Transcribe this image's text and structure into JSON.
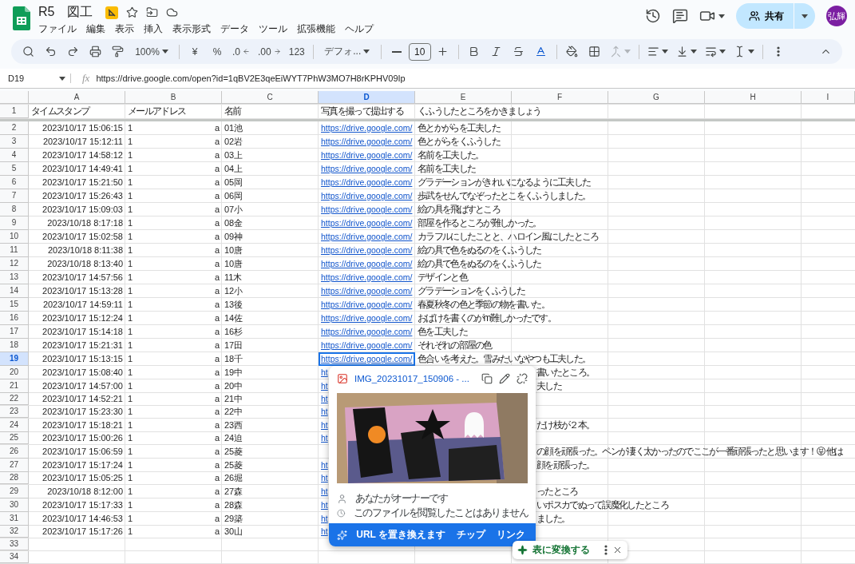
{
  "header": {
    "title": "R5　図工",
    "menu": [
      "ファイル",
      "編集",
      "表示",
      "挿入",
      "表示形式",
      "データ",
      "ツール",
      "拡張機能",
      "ヘルプ"
    ],
    "share_label": "共有",
    "avatar": "弘輝"
  },
  "toolbar": {
    "zoom": "100%",
    "currency": "¥",
    "percent": "%",
    "decrease_decimal": ".0",
    "increase_decimal": ".00",
    "number_format": "123",
    "font": "デフォ...",
    "font_size": "10",
    "merge_disabled": true
  },
  "formula_bar": {
    "cell_ref": "D19",
    "fx": "fx",
    "formula": "https://drive.google.com/open?id=1qBV2E3qeEiWYT7PhW3MO7H8rKPHV09Ip"
  },
  "columns": [
    {
      "label": "A",
      "selected": false
    },
    {
      "label": "B",
      "selected": false
    },
    {
      "label": "C",
      "selected": false
    },
    {
      "label": "D",
      "selected": true
    },
    {
      "label": "E",
      "selected": false
    },
    {
      "label": "F",
      "selected": false
    },
    {
      "label": "G",
      "selected": false
    },
    {
      "label": "H",
      "selected": false
    },
    {
      "label": "I",
      "selected": false
    }
  ],
  "header_row": {
    "number": "1",
    "cells": [
      "タイムスタンプ",
      "メールアドレス",
      "名前",
      "写真を撮って提出する",
      "くふうしたところをかきましょう"
    ]
  },
  "rows": [
    {
      "number": "2",
      "timestamp": "2023/10/17 15:06:15",
      "email": "1",
      "email_end": "a",
      "name": "01池",
      "link": "https://drive.google.com/",
      "note": "色とかがらを工夫した",
      "kind": "full",
      "selected": false
    },
    {
      "number": "3",
      "timestamp": "2023/10/17 15:12:11",
      "email": "1",
      "email_end": "a",
      "name": "02岩",
      "link": "https://drive.google.com/",
      "note": "色とがらをくふうした",
      "kind": "full",
      "selected": false
    },
    {
      "number": "4",
      "timestamp": "2023/10/17 14:58:12",
      "email": "1",
      "email_end": "a",
      "name": "03上",
      "link": "https://drive.google.com/",
      "note": "名前を工夫した。",
      "kind": "full",
      "selected": false
    },
    {
      "number": "5",
      "timestamp": "2023/10/17 14:49:41",
      "email": "1",
      "email_end": "a",
      "name": "04上",
      "link": "https://drive.google.com/",
      "note": "名前を工夫した",
      "kind": "full",
      "selected": false
    },
    {
      "number": "6",
      "timestamp": "2023/10/17 15:21:50",
      "email": "1",
      "email_end": "a",
      "name": "05岡",
      "link": "https://drive.google.com/",
      "note": "グラデーションがきれいになるように工夫した",
      "kind": "full",
      "selected": false
    },
    {
      "number": "7",
      "timestamp": "2023/10/17 15:26:43",
      "email": "1",
      "email_end": "a",
      "name": "06岡",
      "link": "https://drive.google.com/",
      "note": "歩武をせんでなぞったとこをくふうしました。",
      "kind": "full",
      "selected": false
    },
    {
      "number": "8",
      "timestamp": "2023/10/17 15:09:03",
      "email": "1",
      "email_end": "a",
      "name": "07小",
      "link": "https://drive.google.com/",
      "note": "絵の具を飛ばすところ",
      "kind": "full",
      "selected": false
    },
    {
      "number": "9",
      "timestamp": "2023/10/18 8:17:18",
      "email": "1",
      "email_end": "a",
      "name": "08金",
      "link": "https://drive.google.com/",
      "note": "部屋を作るところが難しかった。",
      "kind": "full",
      "selected": false
    },
    {
      "number": "10",
      "timestamp": "2023/10/17 15:02:58",
      "email": "1",
      "email_end": "a",
      "name": "09神",
      "link": "https://drive.google.com/",
      "note": "カラフルにしたことと、ハロイン風にしたところ",
      "kind": "full",
      "selected": false
    },
    {
      "number": "11",
      "timestamp": "2023/10/18 8:11:38",
      "email": "1",
      "email_end": "a",
      "name": "10唐",
      "link": "https://drive.google.com/",
      "note": "絵の具で色をぬるのをくふうした",
      "kind": "full",
      "selected": false
    },
    {
      "number": "12",
      "timestamp": "2023/10/18 8:13:40",
      "email": "1",
      "email_end": "a",
      "name": "10唐",
      "link": "https://drive.google.com/",
      "note": "絵の具で色をぬるのをくふうした",
      "kind": "full",
      "selected": false
    },
    {
      "number": "13",
      "timestamp": "2023/10/17 14:57:56",
      "email": "1",
      "email_end": "a",
      "name": "11木",
      "link": "https://drive.google.com/",
      "note": "デザインと色",
      "kind": "full",
      "selected": false
    },
    {
      "number": "14",
      "timestamp": "2023/10/17 15:13:28",
      "email": "1",
      "email_end": "a",
      "name": "12小",
      "link": "https://drive.google.com/",
      "note": "グラデーションをくふうした",
      "kind": "full",
      "selected": false
    },
    {
      "number": "15",
      "timestamp": "2023/10/17 14:59:11",
      "email": "1",
      "email_end": "a",
      "name": "13後",
      "link": "https://drive.google.com/",
      "note": "春夏秋冬の色と季節の物を書いた。",
      "kind": "full",
      "selected": false
    },
    {
      "number": "16",
      "timestamp": "2023/10/17 15:12:24",
      "email": "1",
      "email_end": "a",
      "name": "14佐",
      "link": "https://drive.google.com/",
      "note": "おばけを書くのがm難しかったです。",
      "kind": "full",
      "selected": false
    },
    {
      "number": "17",
      "timestamp": "2023/10/17 15:14:18",
      "email": "1",
      "email_end": "a",
      "name": "16杉",
      "link": "https://drive.google.com/",
      "note": "色を工夫した",
      "kind": "full",
      "selected": false
    },
    {
      "number": "18",
      "timestamp": "2023/10/17 15:21:31",
      "email": "1",
      "email_end": "a",
      "name": "17田",
      "link": "https://drive.google.com/",
      "note": "それぞれの部屋の色",
      "kind": "full",
      "selected": false
    },
    {
      "number": "19",
      "timestamp": "2023/10/17 15:13:15",
      "email": "1",
      "email_end": "a",
      "name": "18千",
      "link": "https://drive.google.com/",
      "note": "色合いを考えた。雪みたいなやつも工夫した。",
      "kind": "full",
      "selected": true
    },
    {
      "number": "20",
      "timestamp": "2023/10/17 15:08:40",
      "email": "1",
      "email_end": "a",
      "name": "19中",
      "link": "ht",
      "note": "書いたところ。",
      "kind": "behind_popup",
      "selected": false
    },
    {
      "number": "21",
      "timestamp": "2023/10/17 14:57:00",
      "email": "1",
      "email_end": "a",
      "name": "20中",
      "link": "ht",
      "note": "夫した",
      "kind": "behind_popup",
      "selected": false
    },
    {
      "number": "22",
      "timestamp": "2023/10/17 14:52:21",
      "email": "1",
      "email_end": "a",
      "name": "21中",
      "link": "ht",
      "kind": "behind_popup",
      "selected": false
    },
    {
      "number": "23",
      "timestamp": "2023/10/17 15:23:30",
      "email": "1",
      "email_end": "a",
      "name": "22中",
      "link": "ht",
      "kind": "behind_popup",
      "selected": false
    },
    {
      "number": "24",
      "timestamp": "2023/10/17 15:18:21",
      "email": "1",
      "email_end": "a",
      "name": "23西",
      "link": "ht",
      "note": "だけ枝が２本。",
      "kind": "behind_popup",
      "selected": false
    },
    {
      "number": "25",
      "timestamp": "2023/10/17 15:00:26",
      "email": "1",
      "email_end": "a",
      "name": "24迫",
      "link": "ht",
      "kind": "behind_popup",
      "selected": false
    },
    {
      "number": "26",
      "timestamp": "2023/10/17 15:06:59",
      "email": "1",
      "email_end": "a",
      "name": "25菱",
      "note": "の顔を頑張った。ペンが凄く太かったのでここが一番頑張ったと思います！😝 他は",
      "kind": "behind_popup",
      "selected": false
    },
    {
      "number": "27",
      "timestamp": "2023/10/17 15:17:24",
      "email": "1",
      "email_end": "a",
      "name": "25菱",
      "link": "ht",
      "note": "顔を頑張った。",
      "kind": "behind_popup",
      "selected": false
    },
    {
      "number": "28",
      "timestamp": "2023/10/17 15:05:25",
      "email": "1",
      "email_end": "a",
      "name": "26堀",
      "link": "ht",
      "kind": "behind_popup",
      "selected": false
    },
    {
      "number": "29",
      "timestamp": "2023/10/18 8:12:00",
      "email": "1",
      "email_end": "a",
      "name": "27森",
      "link": "ht",
      "note": "ったところ",
      "kind": "behind_popup",
      "selected": false
    },
    {
      "number": "30",
      "timestamp": "2023/10/17 15:17:33",
      "email": "1",
      "email_end": "a",
      "name": "28森",
      "link": "ht",
      "note": "いポスカでぬって誤魔化したところ",
      "kind": "behind_popup",
      "selected": false
    },
    {
      "number": "31",
      "timestamp": "2023/10/17 14:46:53",
      "email": "1",
      "email_end": "a",
      "name": "29築",
      "link": "ht",
      "note": "ました。",
      "kind": "behind_popup",
      "selected": false
    },
    {
      "number": "32",
      "timestamp": "2023/10/17 15:17:26",
      "email": "1",
      "email_end": "a",
      "name": "30山",
      "link": "ht",
      "kind": "behind_popup",
      "selected": false
    },
    {
      "number": "33",
      "kind": "empty",
      "selected": false
    },
    {
      "number": "34",
      "kind": "empty",
      "selected": false
    }
  ],
  "link_popup": {
    "file_name": "IMG_20231017_150906 - ...",
    "owner": "あなたがオーナーです",
    "viewed": "このファイルを閲覧したことはありません",
    "replace_label": "URL を置き換えます",
    "chip_button": "チップ",
    "link_button": "リンク"
  },
  "convert_toast": {
    "label": "表に変換する"
  }
}
